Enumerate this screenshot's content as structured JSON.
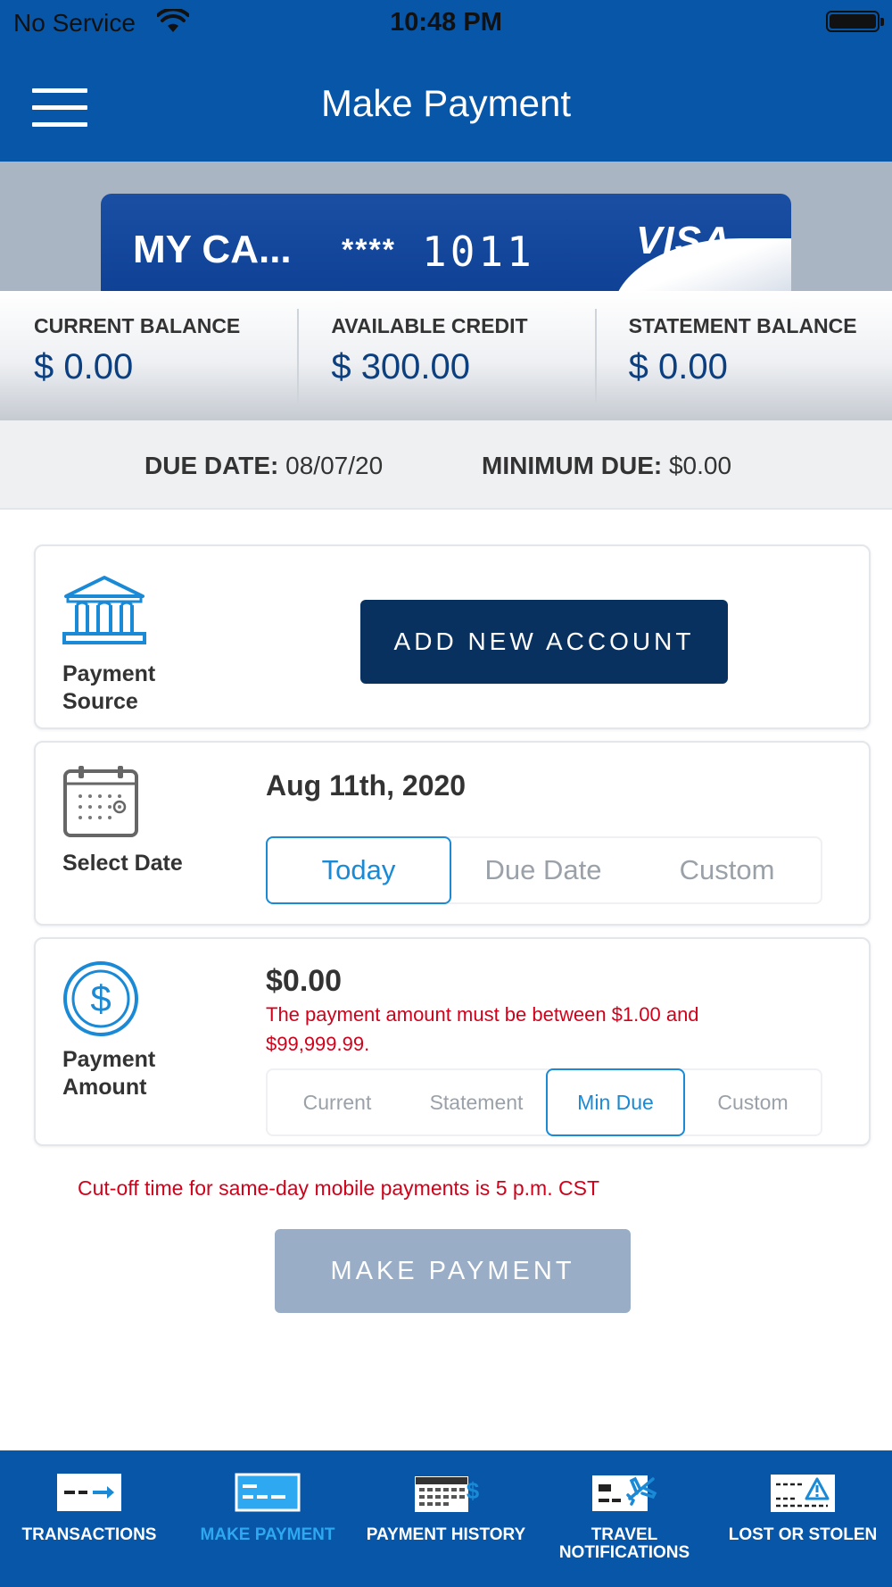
{
  "status_bar": {
    "carrier": "No Service",
    "time": "10:48 PM"
  },
  "header": {
    "title": "Make Payment"
  },
  "card": {
    "name": "MY CA...",
    "mask": "****",
    "last4": "1011",
    "brand": "VISA"
  },
  "balances": [
    {
      "label": "CURRENT BALANCE",
      "value": "$ 0.00"
    },
    {
      "label": "AVAILABLE CREDIT",
      "value": "$ 300.00"
    },
    {
      "label": "STATEMENT BALANCE",
      "value": "$ 0.00"
    }
  ],
  "due": {
    "due_date_label": "DUE DATE:",
    "due_date_value": "08/07/20",
    "min_due_label": "MINIMUM DUE:",
    "min_due_value": "$0.00"
  },
  "payment_source": {
    "label": "Payment Source",
    "button": "ADD NEW ACCOUNT",
    "icon": "bank-icon"
  },
  "select_date": {
    "label": "Select Date",
    "value": "Aug 11th, 2020",
    "icon": "calendar-icon",
    "options": [
      "Today",
      "Due Date",
      "Custom"
    ],
    "selected": "Today"
  },
  "payment_amount": {
    "label": "Payment Amount",
    "value": "$0.00",
    "error": "The payment amount must be between $1.00 and $99,999.99.",
    "icon": "dollar-icon",
    "options": [
      "Current",
      "Statement",
      "Min Due",
      "Custom"
    ],
    "selected": "Min Due"
  },
  "cutoff_note": "Cut-off time for same-day mobile payments is 5 p.m. CST",
  "make_payment_button": "MAKE PAYMENT",
  "tabbar": {
    "items": [
      {
        "label": "TRANSACTIONS",
        "icon": "transactions-icon",
        "active": false
      },
      {
        "label": "MAKE PAYMENT",
        "icon": "make-payment-icon",
        "active": true
      },
      {
        "label": "PAYMENT HISTORY",
        "icon": "payment-history-icon",
        "active": false
      },
      {
        "label": "TRAVEL NOTIFICATIONS",
        "icon": "travel-notifications-icon",
        "active": false
      },
      {
        "label": "LOST OR STOLEN",
        "icon": "lost-or-stolen-icon",
        "active": false
      }
    ]
  },
  "colors": {
    "primary": "#0756a8",
    "dark_button": "#08315f",
    "accent": "#1a8ad6",
    "error": "#d0021b",
    "disabled_button": "#99aec6",
    "active_tab": "#2ea8f0"
  }
}
